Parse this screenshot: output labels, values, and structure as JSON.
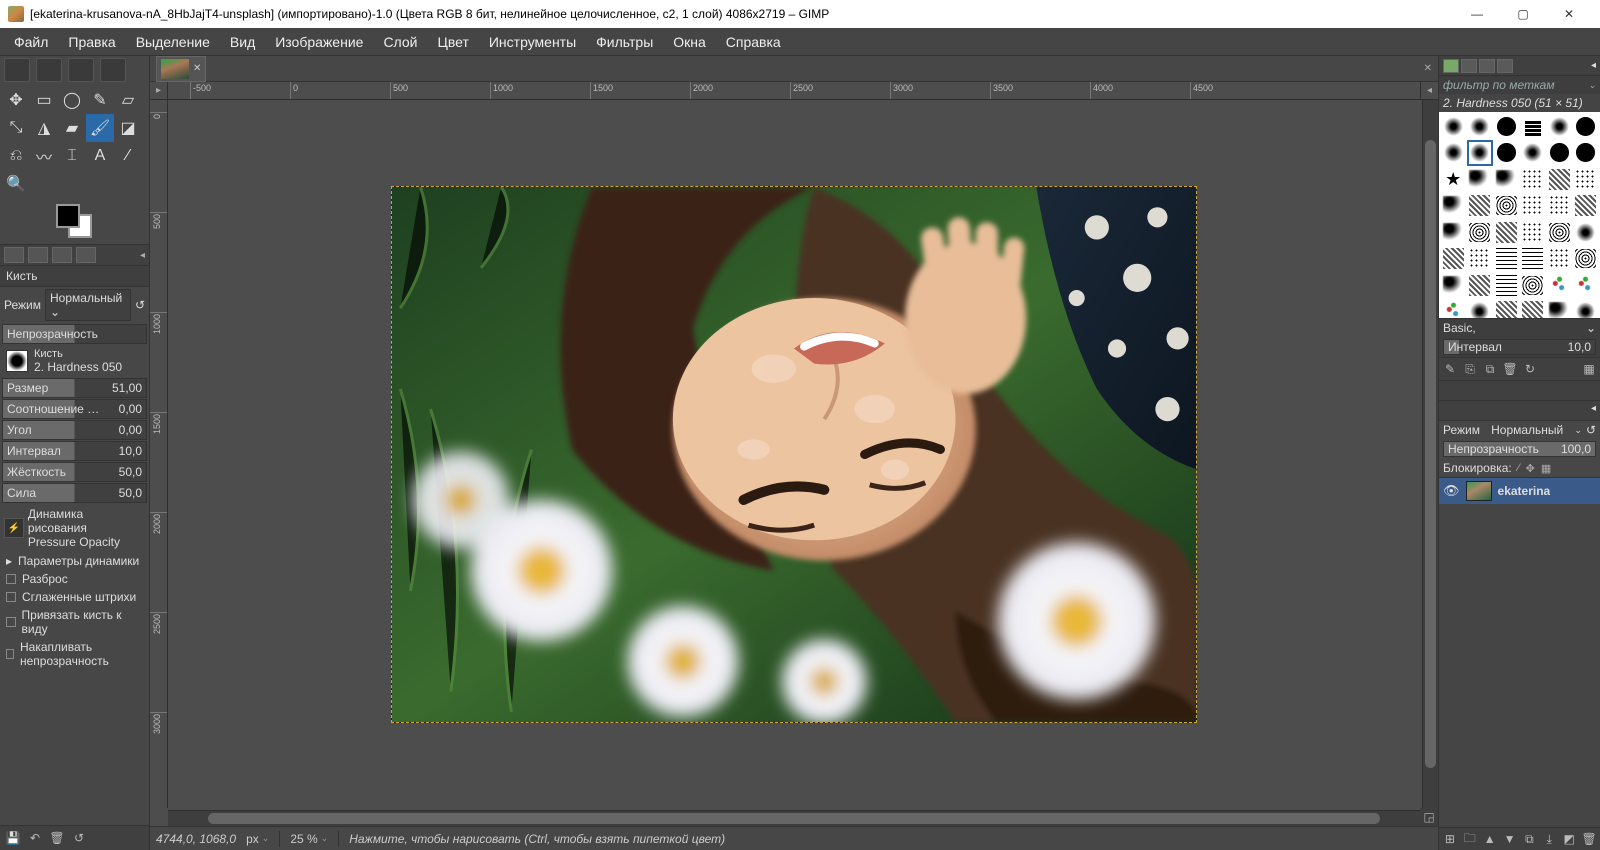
{
  "title": "[ekaterina-krusanova-nA_8HbJajT4-unsplash] (импортировано)-1.0 (Цвета RGB 8 бит, нелинейное целочисленное, c2, 1 слой) 4086x2719 – GIMP",
  "menu": [
    "Файл",
    "Правка",
    "Выделение",
    "Вид",
    "Изображение",
    "Слой",
    "Цвет",
    "Инструменты",
    "Фильтры",
    "Окна",
    "Справка"
  ],
  "tool_options": {
    "panel_title": "Кисть",
    "mode_label": "Режим",
    "mode_value": "Нормальный",
    "opacity_label": "Непрозрачность",
    "brush_small": "Кисть",
    "brush_name": "2. Hardness 050",
    "rows": [
      {
        "label": "Размер",
        "val": "51,00"
      },
      {
        "label": "Соотношение с...",
        "val": "0,00"
      },
      {
        "label": "Угол",
        "val": "0,00"
      },
      {
        "label": "Интервал",
        "val": "10,0"
      },
      {
        "label": "Жёсткость",
        "val": "50,0"
      },
      {
        "label": "Сила",
        "val": "50,0"
      }
    ],
    "dyn_label": "Динамика рисования",
    "dyn_value": "Pressure Opacity",
    "params": "Параметры динамики",
    "checks": [
      "Разброс",
      "Сглаженные штрихи",
      "Привязать кисть к виду",
      "Накапливать непрозрачность"
    ]
  },
  "brushes": {
    "filter": "фильтр по меткам",
    "title": "2. Hardness 050 (51 × 51)",
    "preset": "Basic,",
    "spacing_label": "Интервал",
    "spacing_val": "10,0"
  },
  "layers": {
    "mode_label": "Режим",
    "mode_value": "Нормальный",
    "opacity_label": "Непрозрачность",
    "opacity_val": "100,0",
    "lock_label": "Блокировка:",
    "layer_name": "ekaterina"
  },
  "status": {
    "coords": "4744,0, 1068,0",
    "unit": "px",
    "zoom": "25 %",
    "hint": "Нажмите, чтобы нарисовать (Ctrl, чтобы взять пипеткой цвет)"
  },
  "h_ticks": [
    {
      "v": "-500",
      "p": 22
    },
    {
      "v": "0",
      "p": 122
    },
    {
      "v": "500",
      "p": 222
    },
    {
      "v": "1000",
      "p": 322
    },
    {
      "v": "1500",
      "p": 422
    },
    {
      "v": "2000",
      "p": 522
    },
    {
      "v": "2500",
      "p": 622
    },
    {
      "v": "3000",
      "p": 722
    },
    {
      "v": "3500",
      "p": 822
    },
    {
      "v": "4000",
      "p": 922
    },
    {
      "v": "4500",
      "p": 1022
    }
  ],
  "v_ticks": [
    {
      "v": "0",
      "p": 12
    },
    {
      "v": "500",
      "p": 112
    },
    {
      "v": "1000",
      "p": 212
    },
    {
      "v": "1500",
      "p": 312
    },
    {
      "v": "2000",
      "p": 412
    },
    {
      "v": "2500",
      "p": 512
    },
    {
      "v": "3000",
      "p": 612
    }
  ]
}
